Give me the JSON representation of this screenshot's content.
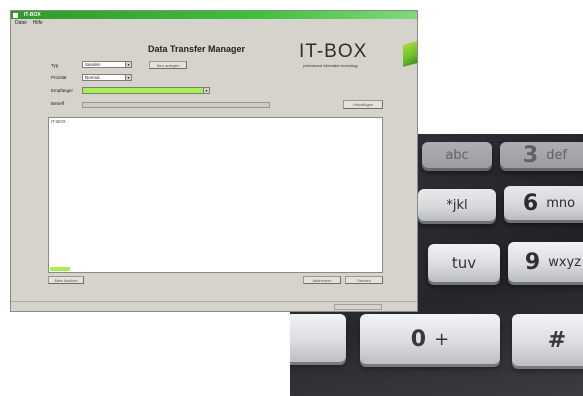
{
  "window": {
    "title": "IT-BOX",
    "menu": [
      "Datei",
      "Hilfe"
    ],
    "app_title": "Data Transfer Manager",
    "logo": {
      "word": "IT-BOX",
      "tagline": "professional information technology"
    },
    "form": {
      "typ_label": "Typ",
      "typ_value": "Senden",
      "prioritat_label": "Priorität",
      "prioritat_value": "Normal",
      "empfanger_label": "Empfänger",
      "empfanger_value": "",
      "betreff_label": "Betreff",
      "new_button": "Neu anlegen",
      "browse_button": "Hinzufügen"
    },
    "log": {
      "first_line": "IT-BOX",
      "progress": 0.06
    },
    "buttons": {
      "bottom_left": "Alles löschen",
      "bottom_right_1": "Abbrechen",
      "bottom_right_2": "Senden"
    },
    "accent_color": "#3fbf3a",
    "highlight_color": "#a6f050"
  },
  "keyboard": {
    "keys": [
      {
        "main": "",
        "sub": "abc"
      },
      {
        "main": "3",
        "sub": "def"
      },
      {
        "main": "",
        "sub": "*jkl"
      },
      {
        "main": "6",
        "sub": "mno"
      },
      {
        "main": "",
        "sub": "tuv"
      },
      {
        "main": "9",
        "sub": "wxyz"
      },
      {
        "main": "",
        "sub": ""
      },
      {
        "main": "0",
        "sub": "+"
      },
      {
        "main": "#",
        "sub": ""
      }
    ]
  }
}
